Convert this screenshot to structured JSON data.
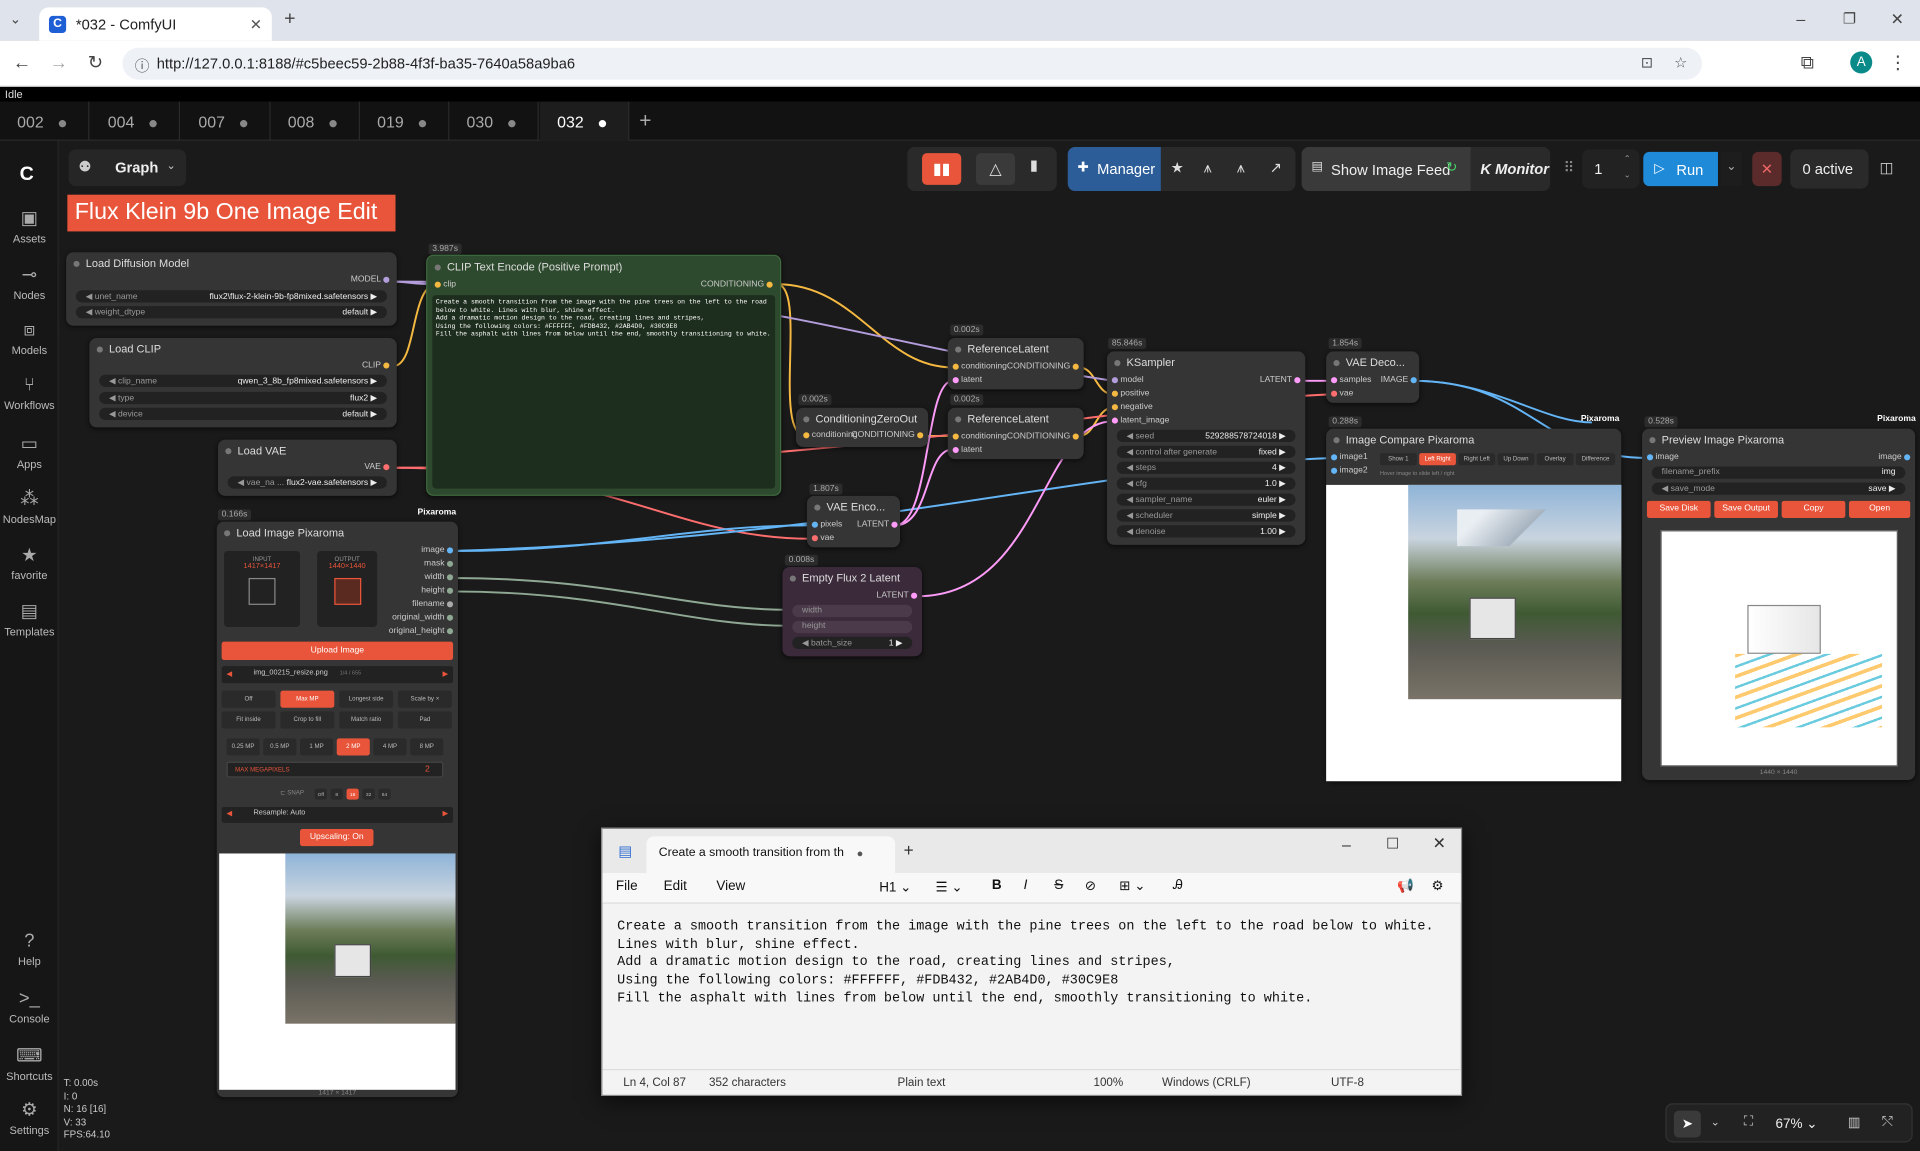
{
  "browser": {
    "tab_title": "*032 - ComfyUI",
    "url": "http://127.0.0.1:8188/#c5beec59-2b88-4f3f-ba35-7640a58a9ba6",
    "avatar_letter": "A"
  },
  "status_text": "Idle",
  "workflow_tabs": [
    "002",
    "004",
    "007",
    "008",
    "019",
    "030",
    "032"
  ],
  "sidebar": {
    "items": [
      {
        "label": "Assets",
        "icon": "image-icon"
      },
      {
        "label": "Nodes",
        "icon": "nodes-icon"
      },
      {
        "label": "Models",
        "icon": "models-icon"
      },
      {
        "label": "Workflows",
        "icon": "workflows-icon"
      },
      {
        "label": "Apps",
        "icon": "apps-icon"
      },
      {
        "label": "NodesMap",
        "icon": "nodesmap-icon"
      },
      {
        "label": "favorite",
        "icon": "star-icon"
      },
      {
        "label": "Templates",
        "icon": "templates-icon"
      }
    ],
    "bottom_items": [
      {
        "label": "Help"
      },
      {
        "label": "Console"
      },
      {
        "label": "Shortcuts"
      },
      {
        "label": "Settings"
      }
    ],
    "stats": [
      "T: 0.00s",
      "I: 0",
      "N: 16 [16]",
      "V: 33",
      "FPS:64.10"
    ]
  },
  "toolbar": {
    "graph_label": "Graph",
    "manager_label": "Manager",
    "show_image_feed": "Show Image Feed",
    "monitor": "K Monitor",
    "batch_count": "1",
    "run_label": "Run",
    "active_label": "0 active",
    "zoom": "67%"
  },
  "group_title": "Flux Klein 9b One Image Edit",
  "nodes": {
    "load_diffusion": {
      "title": "Load Diffusion Model",
      "out": "MODEL",
      "w1_name": "unet_name",
      "w1_val": "flux2\\flux-2-klein-9b-fp8mixed.safetensors",
      "w2_name": "weight_dtype",
      "w2_val": "default"
    },
    "load_clip": {
      "title": "Load CLIP",
      "out": "CLIP",
      "w1_name": "clip_name",
      "w1_val": "qwen_3_8b_fp8mixed.safetensors",
      "w2_name": "type",
      "w2_val": "flux2",
      "w3_name": "device",
      "w3_val": "default"
    },
    "load_vae": {
      "title": "Load VAE",
      "out": "VAE",
      "w1_name": "vae_na ...",
      "w1_val": "flux2-vae.safetensors"
    },
    "clip_text": {
      "timing": "3.987s",
      "title": "CLIP Text Encode (Positive Prompt)",
      "in": "clip",
      "out": "CONDITIONING",
      "text": "Create a smooth transition from the image with the pine trees on the left to the road below to white. Lines with blur, shine effect.\nAdd a dramatic motion design to the road, creating lines and stripes,\nUsing the following colors: #FFFFFF, #FDB432, #2AB4D0, #30C9E8\nFill the asphalt with lines from below until the end, smoothly transitioning to white."
    },
    "cond_zero": {
      "timing": "0.002s",
      "title": "ConditioningZeroOut",
      "in": "conditioning",
      "out": "CONDITIONING"
    },
    "ref_latent_1": {
      "timing": "0.002s",
      "title": "ReferenceLatent",
      "in1": "conditioning",
      "in2": "latent",
      "out": "CONDITIONING"
    },
    "ref_latent_2": {
      "timing": "0.002s",
      "title": "ReferenceLatent",
      "in1": "conditioning",
      "in2": "latent",
      "out": "CONDITIONING"
    },
    "vae_encode": {
      "timing": "1.807s",
      "title": "VAE Enco...",
      "in1": "pixels",
      "in2": "vae",
      "out": "LATENT"
    },
    "empty_latent": {
      "timing": "0.008s",
      "title": "Empty Flux 2 Latent",
      "out": "LATENT",
      "in1": "width",
      "in2": "height",
      "w_name": "batch_size",
      "w_val": "1"
    },
    "ksampler": {
      "timing": "85.846s",
      "title": "KSampler",
      "inputs": [
        "model",
        "positive",
        "negative",
        "latent_image"
      ],
      "out": "LATENT",
      "widgets": [
        [
          "seed",
          "529288578724018"
        ],
        [
          "control after generate",
          "fixed"
        ],
        [
          "steps",
          "4"
        ],
        [
          "cfg",
          "1.0"
        ],
        [
          "sampler_name",
          "euler"
        ],
        [
          "scheduler",
          "simple"
        ],
        [
          "denoise",
          "1.00"
        ]
      ]
    },
    "vae_decode": {
      "timing": "1.854s",
      "title": "VAE Deco...",
      "in1": "samples",
      "in2": "vae",
      "out": "IMAGE"
    },
    "image_compare": {
      "timing": "0.288s",
      "title": "Image Compare Pixaroma",
      "badge": "Pixaroma",
      "in1": "image1",
      "in2": "image2",
      "modes": [
        "Show 1",
        "Left Right",
        "Right Left",
        "Up Down",
        "Overlay",
        "Difference"
      ],
      "hint": "Hover image to slide left / right"
    },
    "preview": {
      "timing": "0.528s",
      "title": "Preview Image Pixaroma",
      "badge": "Pixaroma",
      "in": "image",
      "out": "image",
      "w1_name": "filename_prefix",
      "w1_val": "img",
      "w2_name": "save_mode",
      "w2_val": "save",
      "buttons": [
        "Save Disk",
        "Save Output",
        "Copy",
        "Open"
      ],
      "size": "1440 × 1440"
    },
    "load_image": {
      "timing": "0.166s",
      "title": "Load Image Pixaroma",
      "badge": "Pixaroma",
      "outputs": [
        "image",
        "mask",
        "width",
        "height",
        "filename",
        "original_width",
        "original_height"
      ],
      "input_label": "INPUT",
      "input_size": "1417×1417",
      "output_label": "OUTPUT",
      "output_size": "1440×1440",
      "upload": "Upload Image",
      "filename": "img_00215_resize.png",
      "file_index": "1/4 / 655",
      "mode_row": [
        "Off",
        "Max MP",
        "Longest side",
        "Scale by ×"
      ],
      "fit_row": [
        "Fit inside",
        "Crop to fill",
        "Match ratio",
        "Pad"
      ],
      "mp_row": [
        "0.25 MP",
        "0.5 MP",
        "1 MP",
        "2 MP",
        "4 MP",
        "8 MP"
      ],
      "max_label": "MAX MEGAPIXELS",
      "max_val": "2",
      "snap_label": "SNAP",
      "snap_vals": [
        "Off",
        "8",
        "16",
        "32",
        "64"
      ],
      "resample": "Resample: Auto",
      "upscaling": "Upscaling: On",
      "size": "1417 × 1417"
    }
  },
  "notepad": {
    "tab_title": "Create a smooth transition from th",
    "menu": [
      "File",
      "Edit",
      "View"
    ],
    "heading": "H1",
    "lines": [
      "Create a smooth transition from the image with the pine trees on the left to the road below to white.",
      "Lines with blur, shine effect.",
      "Add a dramatic motion design to the road, creating lines and stripes,",
      "Using the following colors: #FFFFFF, #FDB432, #2AB4D0, #30C9E8",
      "Fill the asphalt with lines from below until the end, smoothly transitioning to white."
    ],
    "status": {
      "pos": "Ln 4, Col 87",
      "chars": "352 characters",
      "type": "Plain text",
      "zoom": "100%",
      "eol": "Windows (CRLF)",
      "enc": "UTF-8"
    }
  },
  "colors": {
    "accent": "#e8553a",
    "run": "#1f8ad8",
    "clip_wire": "#f5b942",
    "model_wire": "#b39ddb",
    "vae_wire": "#ff6e6e",
    "image_wire": "#64b5f6",
    "latent_wire": "#ff9cf9"
  }
}
